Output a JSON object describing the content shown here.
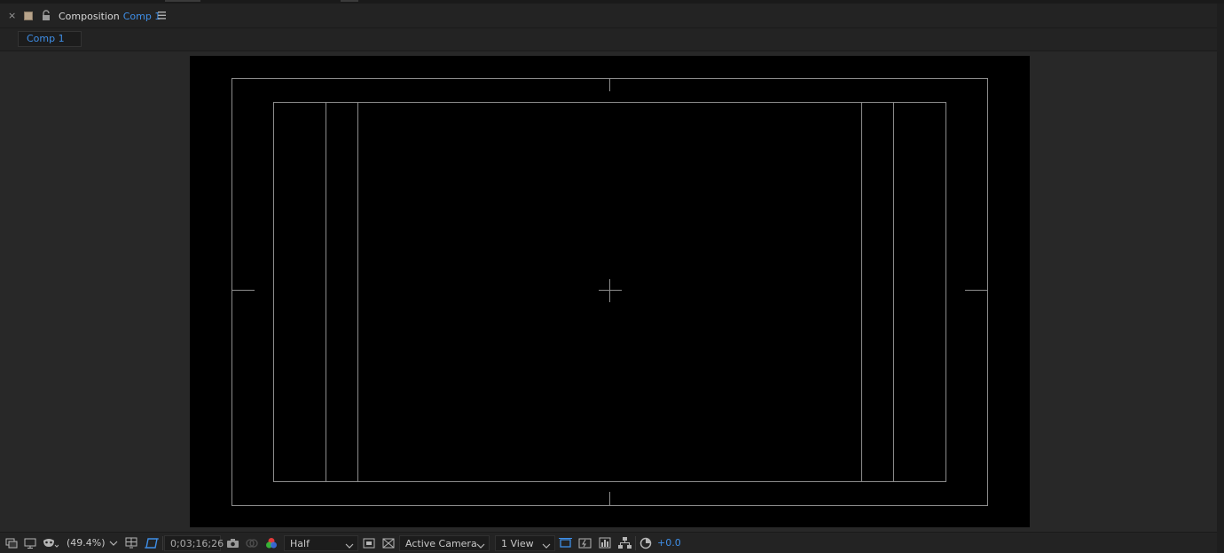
{
  "panel": {
    "title": "Composition",
    "comp_name": "Comp 1",
    "label_color": "#b7a38a"
  },
  "tabs": [
    {
      "label": "Comp 1",
      "active": true
    }
  ],
  "viewer": {
    "background": "#000000",
    "guides_color": "#8c8c8c"
  },
  "toolbar": {
    "zoom": "(49.4%)",
    "timecode": "0;03;16;26",
    "resolution": "Half",
    "camera": "Active Camera",
    "views": "1 View",
    "exposure": "+0.0",
    "accent": "#3f8fe8",
    "icons": [
      "always-preview-icon",
      "monitor-icon",
      "mask-visibility-icon",
      "region-of-interest-icon",
      "transparency-grid-icon",
      "snapshot-icon",
      "show-snapshot-icon",
      "color-channels-icon",
      "fast-previews-icon",
      "toggle-3d-icon",
      "timeline-icon",
      "comp-flowchart-icon",
      "reset-exposure-icon"
    ]
  }
}
